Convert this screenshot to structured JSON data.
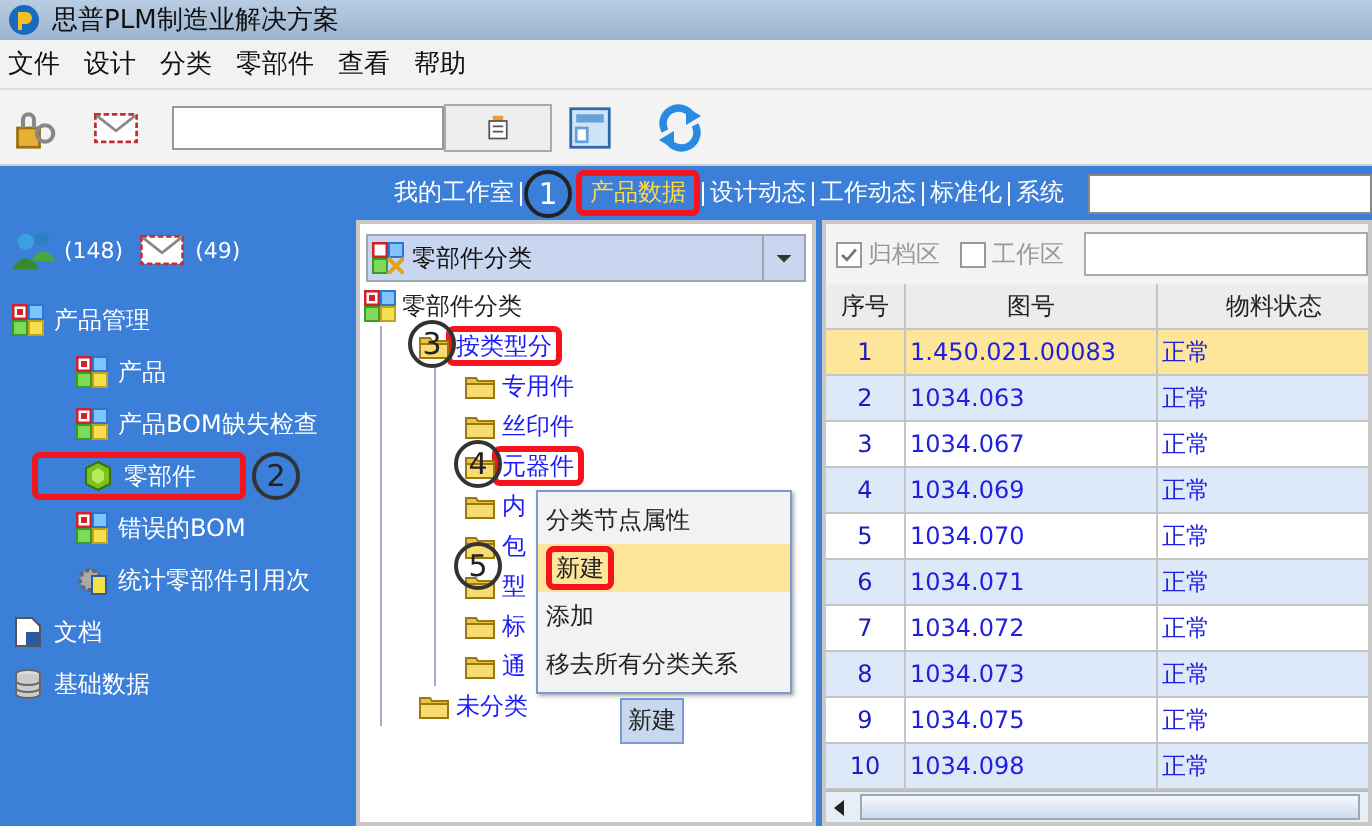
{
  "window": {
    "title": "思普PLM制造业解决方案"
  },
  "menu": [
    "文件",
    "设计",
    "分类",
    "零部件",
    "查看",
    "帮助"
  ],
  "nav": {
    "tabs": [
      {
        "label": "我的工作室",
        "selected": false
      },
      {
        "label": "产品数据",
        "selected": true,
        "callout": "1"
      },
      {
        "label": "设计动态",
        "selected": false
      },
      {
        "label": "工作动态",
        "selected": false
      },
      {
        "label": "标准化",
        "selected": false
      },
      {
        "label": "系统",
        "selected": false
      }
    ]
  },
  "sidebar": {
    "counters": [
      {
        "kind": "users",
        "count": "(148)"
      },
      {
        "kind": "mail",
        "count": "(49)"
      }
    ],
    "items": [
      {
        "label": "产品管理",
        "kind": "grid",
        "children": [
          {
            "label": "产品",
            "kind": "grid"
          },
          {
            "label": "产品BOM缺失检查",
            "kind": "grid"
          },
          {
            "label": "零部件",
            "kind": "gem",
            "callout": "2"
          },
          {
            "label": "错误的BOM",
            "kind": "grid"
          },
          {
            "label": "统计零部件引用次",
            "kind": "gear"
          }
        ]
      },
      {
        "label": "文档",
        "kind": "doc"
      },
      {
        "label": "基础数据",
        "kind": "db"
      }
    ]
  },
  "tree_panel": {
    "dropdown": "零部件分类",
    "tree": [
      {
        "label": "零部件分类",
        "kind": "root",
        "children": [
          {
            "label": "按类型分",
            "kind": "folder",
            "callout": "3",
            "children": [
              {
                "label": "专用件",
                "kind": "folder"
              },
              {
                "label": "丝印件",
                "kind": "folder"
              },
              {
                "label": "元器件",
                "kind": "folder",
                "callout": "4"
              },
              {
                "label": "内",
                "kind": "folder"
              },
              {
                "label": "包",
                "kind": "folder"
              },
              {
                "label": "型",
                "kind": "folder"
              },
              {
                "label": "标",
                "kind": "folder"
              },
              {
                "label": "通",
                "kind": "folder"
              }
            ]
          },
          {
            "label": "未分类",
            "kind": "folder"
          }
        ]
      }
    ],
    "context_menu": [
      {
        "label": "分类节点属性",
        "selected": false
      },
      {
        "label": "新建",
        "selected": true,
        "callout": "5"
      },
      {
        "label": "添加",
        "selected": false
      },
      {
        "label": "移去所有分类关系",
        "selected": false
      }
    ],
    "tooltip": "新建"
  },
  "table": {
    "filters": [
      {
        "label": "归档区",
        "checked": true
      },
      {
        "label": "工作区",
        "checked": false
      }
    ],
    "columns": [
      "序号",
      "图号",
      "物料状态"
    ],
    "rows": [
      {
        "cells": [
          "1",
          "1.450.021.00083",
          "正常"
        ],
        "selected": true
      },
      {
        "cells": [
          "2",
          "1034.063",
          "正常"
        ],
        "selected": false
      },
      {
        "cells": [
          "3",
          "1034.067",
          "正常"
        ],
        "selected": false
      },
      {
        "cells": [
          "4",
          "1034.069",
          "正常"
        ],
        "selected": false
      },
      {
        "cells": [
          "5",
          "1034.070",
          "正常"
        ],
        "selected": false
      },
      {
        "cells": [
          "6",
          "1034.071",
          "正常"
        ],
        "selected": false
      },
      {
        "cells": [
          "7",
          "1034.072",
          "正常"
        ],
        "selected": false
      },
      {
        "cells": [
          "8",
          "1034.073",
          "正常"
        ],
        "selected": false
      },
      {
        "cells": [
          "9",
          "1034.075",
          "正常"
        ],
        "selected": false
      },
      {
        "cells": [
          "10",
          "1034.098",
          "正常"
        ],
        "selected": false
      }
    ]
  }
}
